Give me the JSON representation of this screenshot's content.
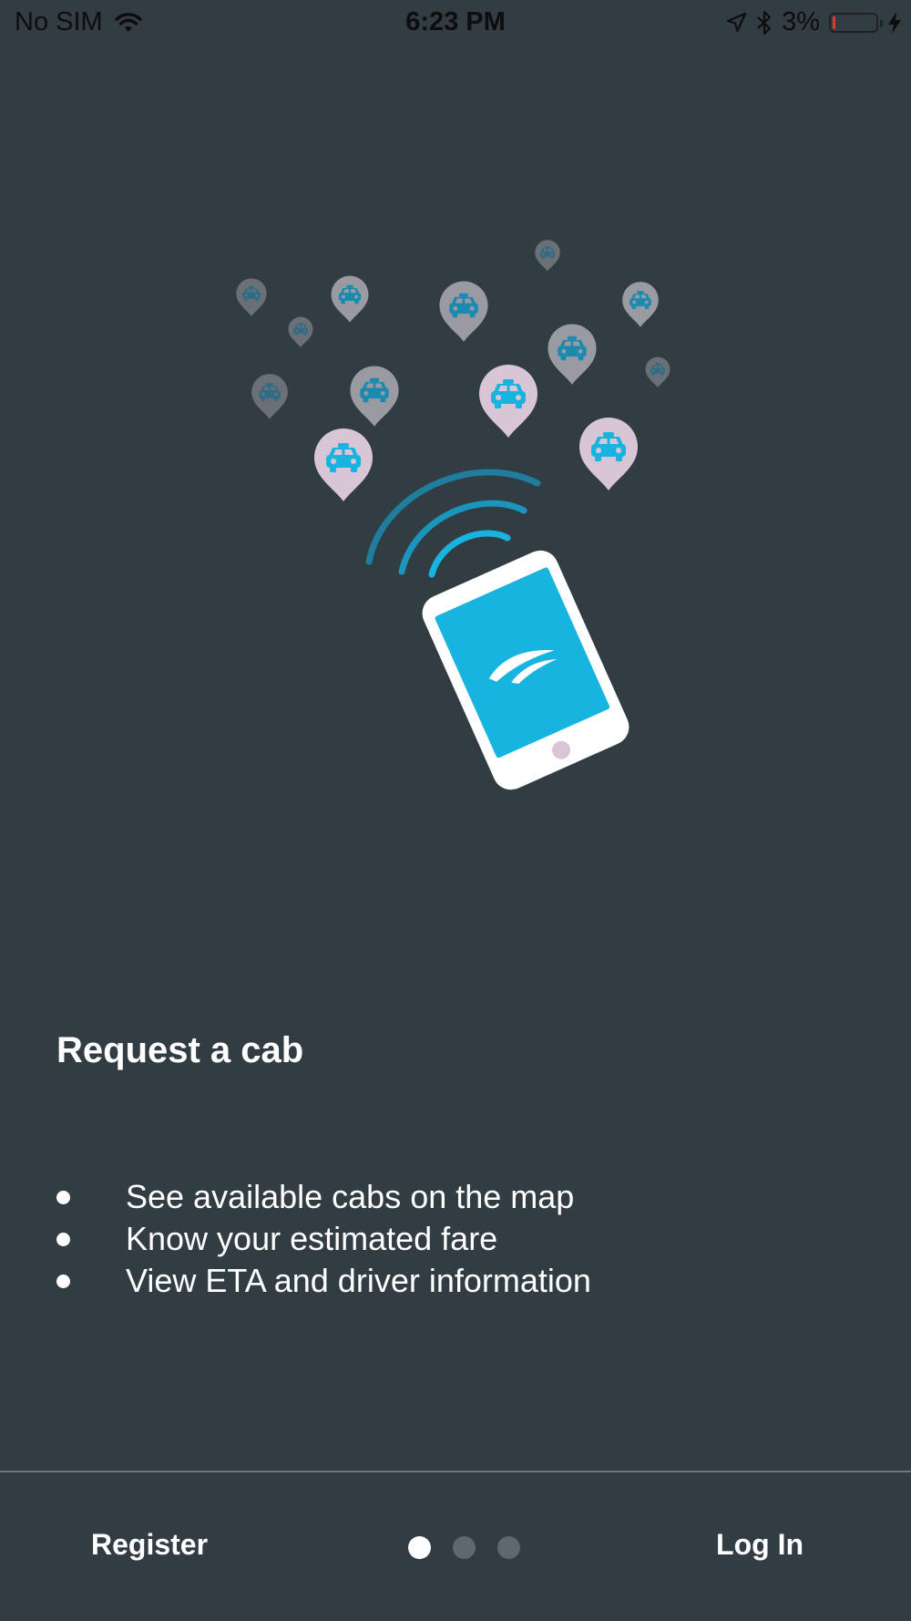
{
  "status_bar": {
    "carrier": "No SIM",
    "time": "6:23 PM",
    "battery_text": "3%",
    "battery_level": 0.03,
    "icons": [
      "wifi-icon",
      "location-arrow-icon",
      "bluetooth-icon",
      "battery-icon",
      "charging-bolt-icon"
    ]
  },
  "illustration": {
    "description_icons": [
      "taxi-pin-icon",
      "phone-icon",
      "signal-waves-icon",
      "app-logo-icon"
    ],
    "colors": {
      "pin_bright": "#d8c6d6",
      "pin_mid": "#9a9aa2",
      "pin_dim": "#6a7076",
      "phone_screen": "#17b4e0",
      "waves": "#1f8fb3"
    }
  },
  "onboarding": {
    "title": "Request a cab",
    "bullets": [
      "See available cabs on the map",
      "Know your estimated fare",
      "View ETA and driver information"
    ]
  },
  "footer": {
    "register_label": "Register",
    "login_label": "Log In",
    "page_indicator": {
      "current": 1,
      "total": 3
    }
  },
  "colors": {
    "background": "#313c43",
    "text": "#ffffff",
    "divider": "#6e7880"
  }
}
